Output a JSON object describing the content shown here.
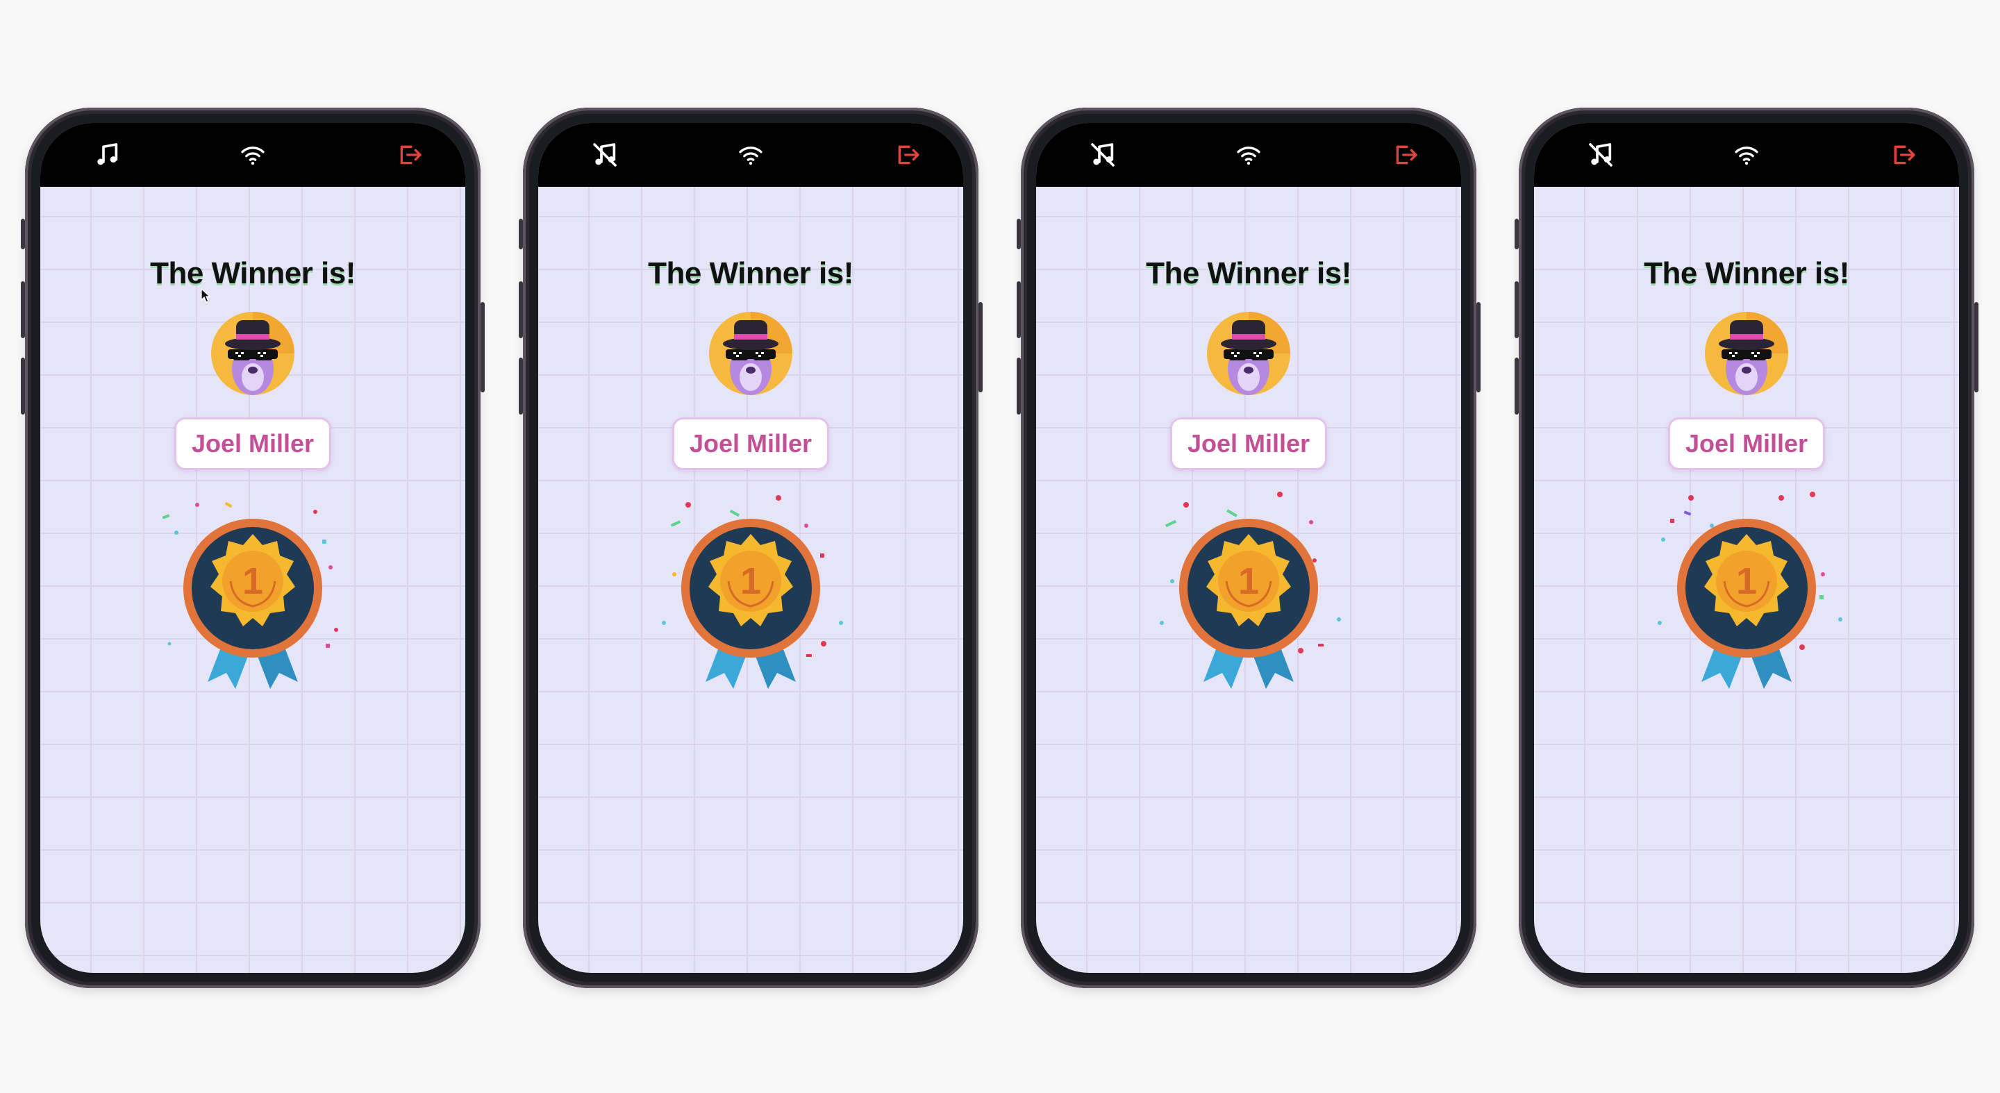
{
  "phones": [
    {
      "topbar": {
        "music_icon": "music-note-icon",
        "wifi_icon": "wifi-icon",
        "exit_icon": "exit-icon"
      },
      "title": "The Winner is!",
      "winner_name": "Joel Miller",
      "medal_rank": "1"
    },
    {
      "topbar": {
        "music_icon": "music-muted-icon",
        "wifi_icon": "wifi-icon",
        "exit_icon": "exit-icon"
      },
      "title": "The Winner is!",
      "winner_name": "Joel Miller",
      "medal_rank": "1"
    },
    {
      "topbar": {
        "music_icon": "music-muted-icon",
        "wifi_icon": "wifi-icon",
        "exit_icon": "exit-icon"
      },
      "title": "The Winner is!",
      "winner_name": "Joel Miller",
      "medal_rank": "1"
    },
    {
      "topbar": {
        "music_icon": "music-muted-icon",
        "wifi_icon": "wifi-icon",
        "exit_icon": "exit-icon"
      },
      "title": "The Winner is!",
      "winner_name": "Joel Miller",
      "medal_rank": "1"
    }
  ],
  "colors": {
    "screen_bg": "#e6e5f8",
    "exit_icon": "#e0453c",
    "name_text": "#c34f96",
    "medal_ribbon": "#3aa8d8",
    "medal_gold": "#f5b82e",
    "medal_ring": "#e0743a"
  }
}
